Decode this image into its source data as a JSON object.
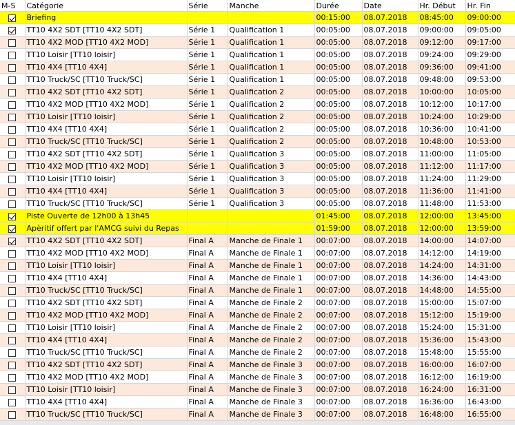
{
  "columns": [
    "M-S",
    "Catégorie",
    "Série",
    "Manche",
    "Durée",
    "Date",
    "Hr. Début",
    "Hr. Fin"
  ],
  "rows": [
    {
      "checked": true,
      "cat": "Briefing",
      "serie": "",
      "manche": "",
      "duree": "00:15:00",
      "date": "08.07.2018",
      "debut": "08:45:00",
      "fin": "09:00:00",
      "style": "yellow"
    },
    {
      "checked": true,
      "cat": "TT10 4X2 SDT  [TT10 4X2 SDT]",
      "serie": "Série 1",
      "manche": "Qualification 1",
      "duree": "00:05:00",
      "date": "08.07.2018",
      "debut": "09:00:00",
      "fin": "09:05:00",
      "style": "white"
    },
    {
      "checked": false,
      "cat": "TT10 4X2 MOD  [TT10 4X2 MOD]",
      "serie": "Série 1",
      "manche": "Qualification 1",
      "duree": "00:05:00",
      "date": "08.07.2018",
      "debut": "09:12:00",
      "fin": "09:17:00",
      "style": "peach"
    },
    {
      "checked": false,
      "cat": "TT10 Loisir  [TT10 loisir]",
      "serie": "Série 1",
      "manche": "Qualification 1",
      "duree": "00:05:00",
      "date": "08.07.2018",
      "debut": "09:24:00",
      "fin": "09:29:00",
      "style": "white"
    },
    {
      "checked": false,
      "cat": "TT10 4X4  [TT10 4X4]",
      "serie": "Série 1",
      "manche": "Qualification 1",
      "duree": "00:05:00",
      "date": "08.07.2018",
      "debut": "09:36:00",
      "fin": "09:41:00",
      "style": "peach"
    },
    {
      "checked": false,
      "cat": "TT10 Truck/SC  [TT10 Truck/SC]",
      "serie": "Série 1",
      "manche": "Qualification 1",
      "duree": "00:05:00",
      "date": "08.07.2018",
      "debut": "09:48:00",
      "fin": "09:53:00",
      "style": "white"
    },
    {
      "checked": false,
      "cat": "TT10 4X2 SDT  [TT10 4X2 SDT]",
      "serie": "Série 1",
      "manche": "Qualification 2",
      "duree": "00:05:00",
      "date": "08.07.2018",
      "debut": "10:00:00",
      "fin": "10:05:00",
      "style": "peach"
    },
    {
      "checked": false,
      "cat": "TT10 4X2 MOD  [TT10 4X2 MOD]",
      "serie": "Série 1",
      "manche": "Qualification 2",
      "duree": "00:05:00",
      "date": "08.07.2018",
      "debut": "10:12:00",
      "fin": "10:17:00",
      "style": "white"
    },
    {
      "checked": false,
      "cat": "TT10 Loisir  [TT10 loisir]",
      "serie": "Série 1",
      "manche": "Qualification 2",
      "duree": "00:05:00",
      "date": "08.07.2018",
      "debut": "10:24:00",
      "fin": "10:29:00",
      "style": "peach"
    },
    {
      "checked": false,
      "cat": "TT10 4X4  [TT10 4X4]",
      "serie": "Série 1",
      "manche": "Qualification 2",
      "duree": "00:05:00",
      "date": "08.07.2018",
      "debut": "10:36:00",
      "fin": "10:41:00",
      "style": "white"
    },
    {
      "checked": false,
      "cat": "TT10 Truck/SC  [TT10 Truck/SC]",
      "serie": "Série 1",
      "manche": "Qualification 2",
      "duree": "00:05:00",
      "date": "08.07.2018",
      "debut": "10:48:00",
      "fin": "10:53:00",
      "style": "peach"
    },
    {
      "checked": false,
      "cat": "TT10 4X2 SDT  [TT10 4X2 SDT]",
      "serie": "Série 1",
      "manche": "Qualification 3",
      "duree": "00:05:00",
      "date": "08.07.2018",
      "debut": "11:00:00",
      "fin": "11:05:00",
      "style": "white"
    },
    {
      "checked": false,
      "cat": "TT10 4X2 MOD  [TT10 4X2 MOD]",
      "serie": "Série 1",
      "manche": "Qualification 3",
      "duree": "00:05:00",
      "date": "08.07.2018",
      "debut": "11:12:00",
      "fin": "11:17:00",
      "style": "peach"
    },
    {
      "checked": false,
      "cat": "TT10 Loisir  [TT10 loisir]",
      "serie": "Série 1",
      "manche": "Qualification 3",
      "duree": "00:05:00",
      "date": "08.07.2018",
      "debut": "11:24:00",
      "fin": "11:29:00",
      "style": "white"
    },
    {
      "checked": false,
      "cat": "TT10 4X4  [TT10 4X4]",
      "serie": "Série 1",
      "manche": "Qualification 3",
      "duree": "00:05:00",
      "date": "08.07.2018",
      "debut": "11:36:00",
      "fin": "11:41:00",
      "style": "peach"
    },
    {
      "checked": false,
      "cat": "TT10 Truck/SC  [TT10 Truck/SC]",
      "serie": "Série 1",
      "manche": "Qualification 3",
      "duree": "00:05:00",
      "date": "08.07.2018",
      "debut": "11:48:00",
      "fin": "11:53:00",
      "style": "white"
    },
    {
      "checked": true,
      "cat": "Piste Ouverte de 12h00 à 13h45",
      "serie": "",
      "manche": "",
      "duree": "01:45:00",
      "date": "08.07.2018",
      "debut": "12:00:00",
      "fin": "13:45:00",
      "style": "yellow"
    },
    {
      "checked": true,
      "cat": "Apèritif offert par l'AMCG suivi du Repas",
      "serie": "",
      "manche": "",
      "duree": "01:59:00",
      "date": "08.07.2018",
      "debut": "12:00:00",
      "fin": "13:59:00",
      "style": "yellow"
    },
    {
      "checked": true,
      "cat": "TT10 4X2 SDT  [TT10 4X2 SDT]",
      "serie": "Final A",
      "manche": "Manche de Finale 1",
      "duree": "00:07:00",
      "date": "08.07.2018",
      "debut": "14:00:00",
      "fin": "14:07:00",
      "style": "peach"
    },
    {
      "checked": false,
      "cat": "TT10 4X2 MOD  [TT10 4X2 MOD]",
      "serie": "Final A",
      "manche": "Manche de Finale 1",
      "duree": "00:07:00",
      "date": "08.07.2018",
      "debut": "14:12:00",
      "fin": "14:19:00",
      "style": "white"
    },
    {
      "checked": false,
      "cat": "TT10 Loisir  [TT10 loisir]",
      "serie": "Final A",
      "manche": "Manche de Finale 1",
      "duree": "00:07:00",
      "date": "08.07.2018",
      "debut": "14:24:00",
      "fin": "14:31:00",
      "style": "peach"
    },
    {
      "checked": false,
      "cat": "TT10 4X4  [TT10 4X4]",
      "serie": "Final A",
      "manche": "Manche de Finale 1",
      "duree": "00:07:00",
      "date": "08.07.2018",
      "debut": "14:36:00",
      "fin": "14:43:00",
      "style": "white"
    },
    {
      "checked": false,
      "cat": "TT10 Truck/SC  [TT10 Truck/SC]",
      "serie": "Final A",
      "manche": "Manche de Finale 1",
      "duree": "00:07:00",
      "date": "08.07.2018",
      "debut": "14:48:00",
      "fin": "14:55:00",
      "style": "peach"
    },
    {
      "checked": false,
      "cat": "TT10 4X2 SDT  [TT10 4X2 SDT]",
      "serie": "Final A",
      "manche": "Manche de Finale 2",
      "duree": "00:07:00",
      "date": "08.07.2018",
      "debut": "15:00:00",
      "fin": "15:07:00",
      "style": "white"
    },
    {
      "checked": false,
      "cat": "TT10 4X2 MOD  [TT10 4X2 MOD]",
      "serie": "Final A",
      "manche": "Manche de Finale 2",
      "duree": "00:07:00",
      "date": "08.07.2018",
      "debut": "15:12:00",
      "fin": "15:19:00",
      "style": "peach"
    },
    {
      "checked": false,
      "cat": "TT10 Loisir  [TT10 loisir]",
      "serie": "Final A",
      "manche": "Manche de Finale 2",
      "duree": "00:07:00",
      "date": "08.07.2018",
      "debut": "15:24:00",
      "fin": "15:31:00",
      "style": "white"
    },
    {
      "checked": false,
      "cat": "TT10 4X4  [TT10 4X4]",
      "serie": "Final A",
      "manche": "Manche de Finale 2",
      "duree": "00:07:00",
      "date": "08.07.2018",
      "debut": "15:36:00",
      "fin": "15:43:00",
      "style": "peach"
    },
    {
      "checked": false,
      "cat": "TT10 Truck/SC  [TT10 Truck/SC]",
      "serie": "Final A",
      "manche": "Manche de Finale 2",
      "duree": "00:07:00",
      "date": "08.07.2018",
      "debut": "15:48:00",
      "fin": "15:55:00",
      "style": "white"
    },
    {
      "checked": false,
      "cat": "TT10 4X2 SDT  [TT10 4X2 SDT]",
      "serie": "Final A",
      "manche": "Manche de Finale 3",
      "duree": "00:07:00",
      "date": "08.07.2018",
      "debut": "16:00:00",
      "fin": "16:07:00",
      "style": "peach"
    },
    {
      "checked": false,
      "cat": "TT10 4X2 MOD  [TT10 4X2 MOD]",
      "serie": "Final A",
      "manche": "Manche de Finale 3",
      "duree": "00:07:00",
      "date": "08.07.2018",
      "debut": "16:12:00",
      "fin": "16:19:00",
      "style": "white"
    },
    {
      "checked": false,
      "cat": "TT10 Loisir  [TT10 loisir]",
      "serie": "Final A",
      "manche": "Manche de Finale 3",
      "duree": "00:07:00",
      "date": "08.07.2018",
      "debut": "16:24:00",
      "fin": "16:31:00",
      "style": "peach"
    },
    {
      "checked": false,
      "cat": "TT10 4X4  [TT10 4X4]",
      "serie": "Final A",
      "manche": "Manche de Finale 3",
      "duree": "00:07:00",
      "date": "08.07.2018",
      "debut": "16:36:00",
      "fin": "16:43:00",
      "style": "white"
    },
    {
      "checked": false,
      "cat": "TT10 Truck/SC  [TT10 Truck/SC]",
      "serie": "Final A",
      "manche": "Manche de Finale 3",
      "duree": "00:07:00",
      "date": "08.07.2018",
      "debut": "16:48:00",
      "fin": "16:55:00",
      "style": "peach"
    }
  ]
}
